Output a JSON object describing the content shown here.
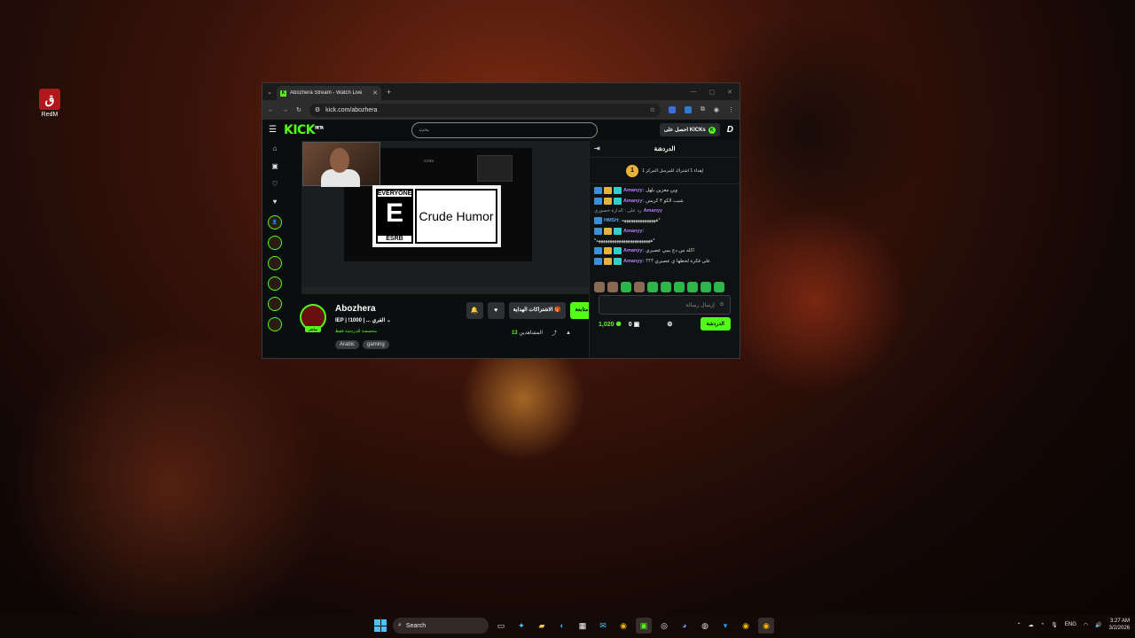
{
  "desktop": {
    "icon_label": "RedM",
    "icon_glyph": "ق"
  },
  "browser": {
    "tab_title": "Abozhera Stream - Watch Live",
    "url": "kick.com/abozhera"
  },
  "kick": {
    "logo": "KICK",
    "logo_sup": "BETA",
    "search_placeholder": "بحث",
    "get_kicks": "احصل على KICKs",
    "streamer": {
      "name": "Abozhera",
      "title": "IEP | !1000 | ... القري",
      "category": "مخصصة للدردشة فقط",
      "tags": [
        "Arabic",
        "gaming"
      ],
      "live_label": "مباشر",
      "viewers_label": "المشاهدين",
      "viewers": "13",
      "follow_label": "متابعة",
      "subs_label": "الاشتراكات الهداية"
    },
    "player": {
      "esrb_top": "EVERYONE",
      "esrb_letter": "E",
      "esrb_bottom": "ESRB",
      "esrb_descriptor": "Crude Humor",
      "inner_label": "GTRD"
    },
    "chat": {
      "header": "الدردشة",
      "pinned_count": "1",
      "pinned_text": "إهداء 1 اشتراك للمرسل المركز 1",
      "messages": [
        {
          "user": "Amanyy:",
          "text": "وين معزين بلهل",
          "user_class": "user"
        },
        {
          "user": "Amanyy:",
          "text": "شيب الكو ٣ كريس",
          "user_class": "user"
        },
        {
          "user": "Amanyy",
          "text": "رد على : الدارة خصوري",
          "user_class": "user"
        },
        {
          "user": "HMSH:",
          "text": "هههههههههههههههه*",
          "user_class": "user2"
        },
        {
          "user": "Amanyy:",
          "text": "",
          "user_class": "user"
        },
        {
          "user": "",
          "text": "*ههههههههههههههههههههههههه*",
          "user_class": "user"
        },
        {
          "user": "Amanyy:",
          "text": "اكله من دج بيبي عصيري",
          "user_class": "user"
        },
        {
          "user": "Amanyy:",
          "text": "على فكرة لحظها ي عصيري ؟؟؟",
          "user_class": "user"
        }
      ],
      "input_placeholder": "إرسال رسالة",
      "points": "1,020",
      "zero": "0",
      "send_label": "الدردشة"
    }
  },
  "taskbar": {
    "search_label": "Search",
    "lang": "ENG",
    "time": "3:27 AM",
    "date": "3/2/2026"
  }
}
